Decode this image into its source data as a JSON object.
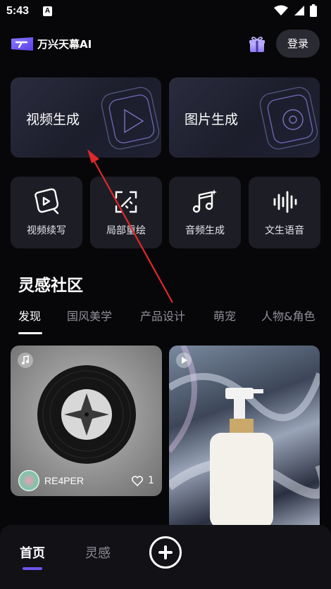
{
  "status_bar": {
    "time": "5:43",
    "notification_letter": "A"
  },
  "header": {
    "app_title": "万兴天幕AI",
    "login_label": "登录"
  },
  "main_tools": [
    {
      "label": "视频生成"
    },
    {
      "label": "图片生成"
    }
  ],
  "small_tools": [
    {
      "label": "视频续写",
      "icon": "video-continue-icon"
    },
    {
      "label": "局部重绘",
      "icon": "magic-repaint-icon"
    },
    {
      "label": "音频生成",
      "icon": "music-note-icon"
    },
    {
      "label": "文生语音",
      "icon": "voice-wave-icon"
    }
  ],
  "community": {
    "title": "灵感社区",
    "tabs": [
      "发现",
      "国风美学",
      "产品设计",
      "萌宠",
      "人物&角色"
    ],
    "active_tab": "发现"
  },
  "feed": [
    {
      "username": "RE4PER",
      "likes": "1",
      "type": "music"
    },
    {
      "type": "video"
    }
  ],
  "bottom_nav": {
    "home": "首页",
    "inspire": "灵感"
  },
  "colors": {
    "accent": "#6c56f0",
    "background": "#07070a",
    "card": "#1d1e25",
    "annotation_arrow": "#e0282a"
  }
}
